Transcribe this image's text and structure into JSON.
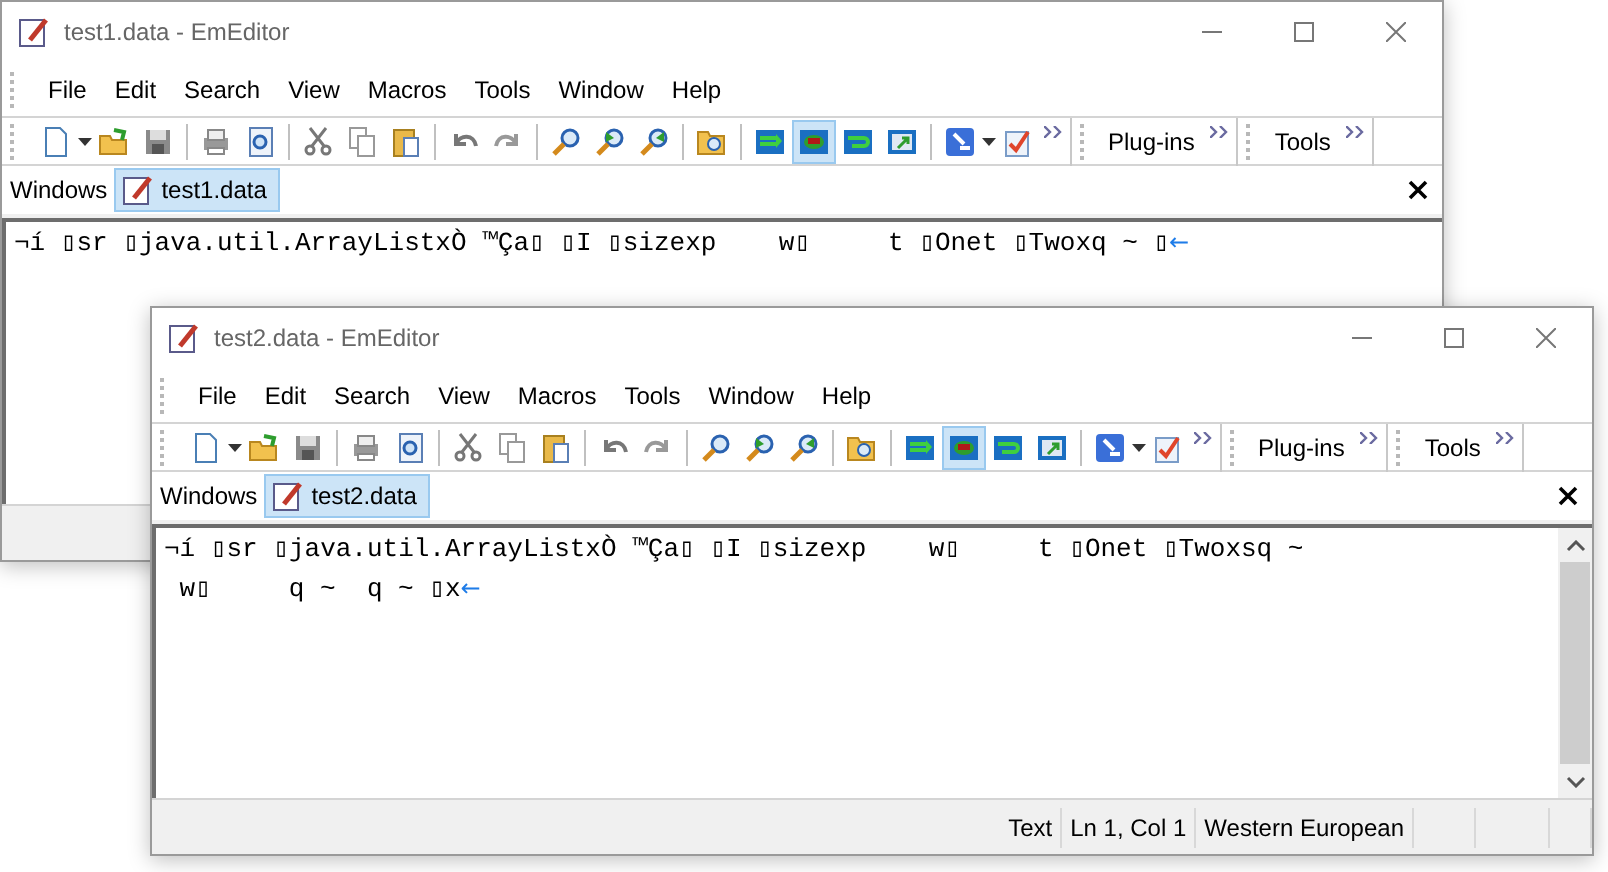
{
  "windows": [
    {
      "title": "test1.data - EmEditor",
      "menu": [
        "File",
        "Edit",
        "Search",
        "View",
        "Macros",
        "Tools",
        "Window",
        "Help"
      ],
      "wrap_buttons": [
        {
          "pressed": false
        },
        {
          "pressed": true
        },
        {
          "pressed": false
        },
        {
          "pressed": false
        }
      ],
      "bands": [
        "Plug-ins",
        "Tools"
      ],
      "windows_label": "Windows",
      "tabs": [
        {
          "label": "test1.data",
          "selected": true
        }
      ],
      "lines": [
        {
          "text": "¬í ▯sr ▯java.util.ArrayListxÒ ™Ça▯ ▯I ▯sizexp    w▯     t ▯Onet ▯Twoxq ~ ▯",
          "end_mark": "←"
        }
      ]
    },
    {
      "title": "test2.data - EmEditor",
      "menu": [
        "File",
        "Edit",
        "Search",
        "View",
        "Macros",
        "Tools",
        "Window",
        "Help"
      ],
      "wrap_buttons": [
        {
          "pressed": false
        },
        {
          "pressed": true
        },
        {
          "pressed": false
        },
        {
          "pressed": false
        }
      ],
      "bands": [
        "Plug-ins",
        "Tools"
      ],
      "windows_label": "Windows",
      "tabs": [
        {
          "label": "test2.data",
          "selected": true
        }
      ],
      "lines": [
        {
          "text": "¬í ▯sr ▯java.util.ArrayListxÒ ™Ça▯ ▯I ▯sizexp    w▯     t ▯Onet ▯Twoxsq ~"
        },
        {
          "text": " w▯     q ~  q ~ ▯x",
          "end_mark": "←"
        }
      ],
      "status_bar": [
        "Text",
        "Ln 1, Col 1",
        "Western European"
      ]
    }
  ]
}
